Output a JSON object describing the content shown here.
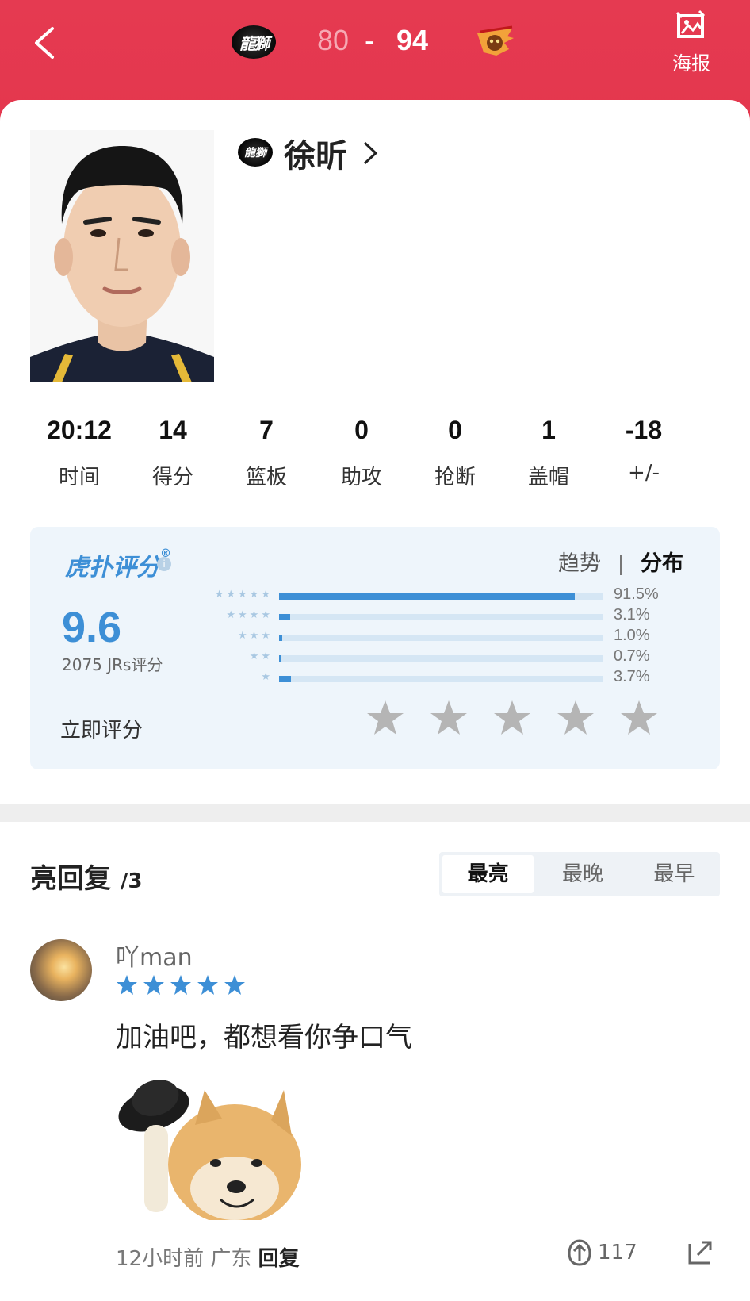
{
  "header": {
    "home_team_logo_text": "龍獅",
    "home_score": "80",
    "dash": "-",
    "away_score": "94",
    "poster_label": "海报"
  },
  "player": {
    "team_mini_logo_text": "龍獅",
    "name": "徐昕"
  },
  "stats": [
    {
      "value": "20:12",
      "label": "时间"
    },
    {
      "value": "14",
      "label": "得分"
    },
    {
      "value": "7",
      "label": "篮板"
    },
    {
      "value": "0",
      "label": "助攻"
    },
    {
      "value": "0",
      "label": "抢断"
    },
    {
      "value": "1",
      "label": "盖帽"
    },
    {
      "value": "-18",
      "label": "+/-"
    }
  ],
  "rating": {
    "brand": "虎扑评分",
    "score": "9.6",
    "count": "2075 JRs评分",
    "tab_trend": "趋势",
    "tab_dist": "分布",
    "distribution": [
      {
        "stars": "★★★★★",
        "pct": "91.5%",
        "value": 0.915
      },
      {
        "stars": "★★★★",
        "pct": "3.1%",
        "value": 0.031
      },
      {
        "stars": "★★★",
        "pct": "1.0%",
        "value": 0.01
      },
      {
        "stars": "★★",
        "pct": "0.7%",
        "value": 0.007
      },
      {
        "stars": "★",
        "pct": "3.7%",
        "value": 0.037
      }
    ],
    "rate_now_label": "立即评分"
  },
  "replies": {
    "title": "亮回复",
    "count": "/3",
    "sort_tabs": [
      "最亮",
      "最晚",
      "最早"
    ],
    "comment": {
      "username": "吖man",
      "user_rating": 5,
      "text": "加油吧，都想看你争口气",
      "time": "12小时前",
      "location": "广东",
      "reply_label": "回复",
      "likes": "117"
    }
  },
  "colors": {
    "header_red": "#e53a51",
    "accent_blue": "#3d8fd6",
    "star_gray": "#b5b5b5"
  }
}
